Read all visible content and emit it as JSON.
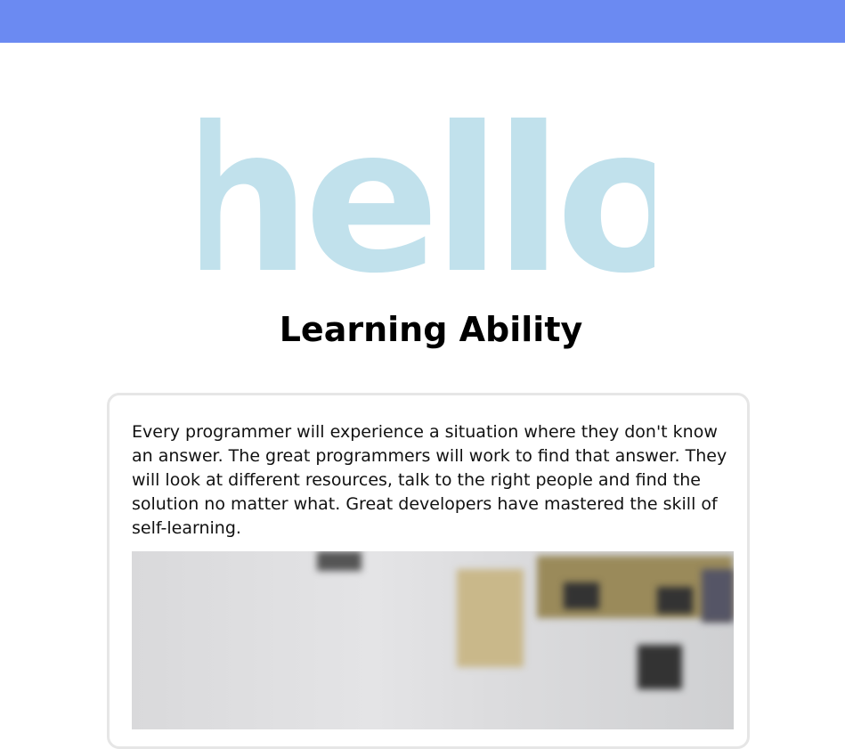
{
  "header": {
    "color": "#6b8af2"
  },
  "logo": {
    "text": "hello",
    "color": "#c1e1ec"
  },
  "page": {
    "title": "Learning Ability"
  },
  "card": {
    "text": "Every programmer will experience a situation where they don't know an answer. The great programmers will work to find that answer. They will look at different resources, talk to the right people and find the solution no matter what. Great developers have mastered the skill of self-learning."
  }
}
